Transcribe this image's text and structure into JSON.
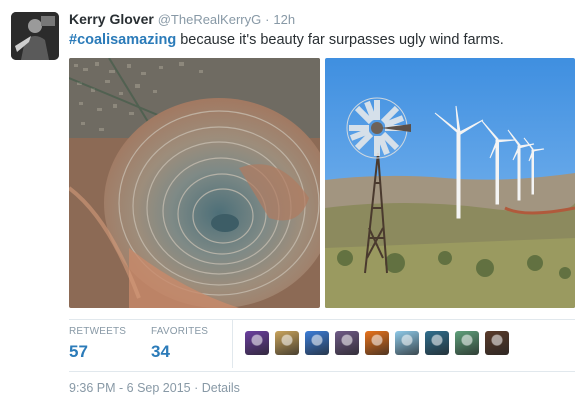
{
  "tweet": {
    "author_name": "Kerry Glover",
    "handle": "@TheRealKerryG",
    "separator": "·",
    "time": "12h",
    "hashtag": "#coalisamazing",
    "text": " because it's beauty far surpasses ugly wind farms."
  },
  "media": [
    {
      "subject": "aerial view of open-pit mine"
    },
    {
      "subject": "windmill and wind turbines"
    }
  ],
  "stats": {
    "retweets_label": "RETWEETS",
    "retweets_count": "57",
    "favorites_label": "FAVORITES",
    "favorites_count": "34"
  },
  "favoriter_avatar_colors": [
    "#6b3fa0",
    "#c9a45c",
    "#3b7dd8",
    "#6f5a87",
    "#e8731c",
    "#8ec9e8",
    "#2f6e8e",
    "#5fa07a",
    "#5a3b2a"
  ],
  "footer": {
    "timestamp": "9:36 PM - 6 Sep 2015",
    "separator": " · ",
    "details_label": "Details"
  },
  "colors": {
    "link_blue": "#2b7bb9",
    "muted_gray": "#8899a6",
    "text_dark": "#292f33"
  }
}
